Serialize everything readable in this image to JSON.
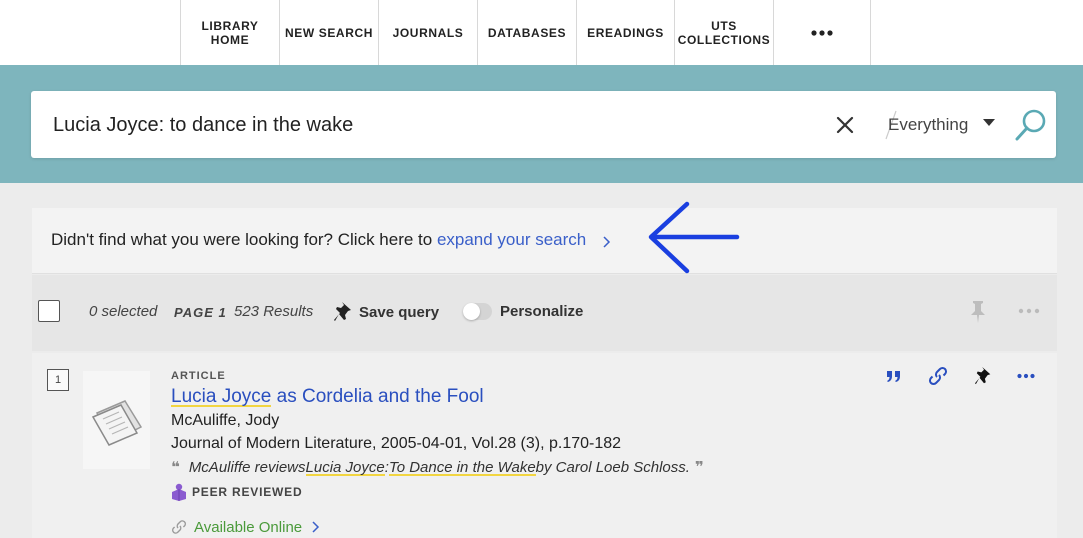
{
  "nav": {
    "items": [
      {
        "line1": "LIBRARY",
        "line2": "HOME"
      },
      {
        "line1": "NEW SEARCH",
        "line2": ""
      },
      {
        "line1": "JOURNALS",
        "line2": ""
      },
      {
        "line1": "DATABASES",
        "line2": ""
      },
      {
        "line1": "EREADINGS",
        "line2": ""
      },
      {
        "line1": "UTS",
        "line2": "COLLECTIONS"
      }
    ],
    "more_icon": "ellipsis-icon"
  },
  "search": {
    "query": "Lucia Joyce: to dance in the wake",
    "scope": "Everything",
    "clear_icon": "close-icon",
    "search_icon": "magnifier-icon"
  },
  "expand": {
    "prefix": "Didn't find what you were looking for? Click here to ",
    "link": "expand your search"
  },
  "toolbar": {
    "selected": "0 selected",
    "page_label": "PAGE",
    "page_number": "1",
    "results": "523 Results",
    "save_query": "Save query",
    "personalize": "Personalize",
    "personalize_on": false
  },
  "result": {
    "number": "1",
    "type": "ARTICLE",
    "title_highlight": "Lucia Joyce",
    "title_rest": " as Cordelia and the Fool",
    "author": "McAuliffe, Jody",
    "source": "Journal of Modern Literature, 2005-04-01, Vol.28 (3), p.170-182",
    "snippet_prefix": "McAuliffe reviews ",
    "snippet_hl1": "Lucia Joyce",
    "snippet_mid": ": ",
    "snippet_hl2": "To Dance in the Wake",
    "snippet_suffix": " by Carol Loeb Schloss.",
    "peer_reviewed": "PEER REVIEWED",
    "availability": "Available Online"
  },
  "colors": {
    "band": "#7eb5bd",
    "link_blue": "#2a4fbf",
    "arrow_blue": "#1a3fe0",
    "highlight": "#f2d541",
    "available_green": "#4a9a3a",
    "peer_purple": "#8a5bd0"
  }
}
